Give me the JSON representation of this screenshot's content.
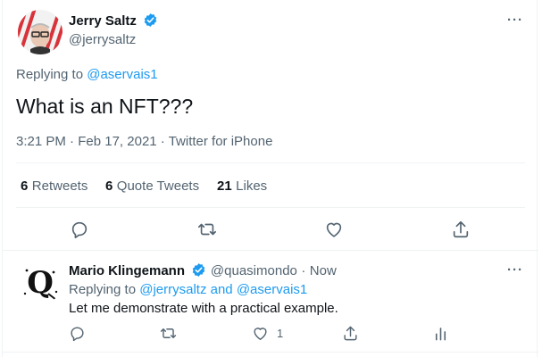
{
  "main_tweet": {
    "author_name": "Jerry Saltz",
    "author_handle": "@jerrysaltz",
    "replying_prefix": "Replying to",
    "replying_to": "@aservais1",
    "text": "What is an NFT???",
    "time": "3:21 PM",
    "date": "Feb 17, 2021",
    "source": "Twitter for iPhone",
    "separator": "·",
    "more_label": "···"
  },
  "stats": {
    "retweets_count": "6",
    "retweets_label": "Retweets",
    "quotes_count": "6",
    "quotes_label": "Quote Tweets",
    "likes_count": "21",
    "likes_label": "Likes"
  },
  "reply_tweet": {
    "author_name": "Mario Klingemann",
    "author_handle": "@quasimondo",
    "separator": "·",
    "time": "Now",
    "replying_prefix": "Replying to",
    "replying_to_1": "@jerrysaltz",
    "and_word": "and",
    "replying_to_2": "@aservais1",
    "text": "Let me demonstrate with a practical example.",
    "like_count": "1",
    "more_label": "···"
  },
  "icons": [
    "verified-icon",
    "reply-icon",
    "retweet-icon",
    "like-icon",
    "share-icon",
    "analytics-icon",
    "more-icon"
  ],
  "colors": {
    "accent": "#1d9bf0",
    "muted": "#536471",
    "text": "#0f1419",
    "divider": "#eff3f4"
  }
}
